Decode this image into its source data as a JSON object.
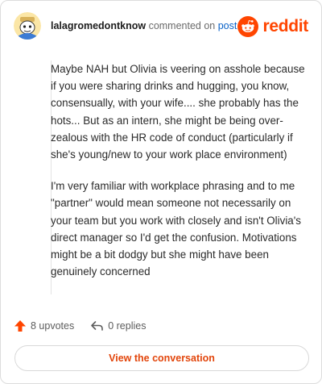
{
  "comment": {
    "username": "lalagromedontknow",
    "action_text": "commented on",
    "post_link": "post",
    "paragraphs": [
      "Maybe NAH but Olivia is veering on asshole because if you were sharing drinks and hugging, you know, consensually, with your wife.... she probably has the hots... But as an intern, she might be being over-zealous with the HR code of conduct (particularly if she's young/new to your work place environment)",
      "I'm very familiar with workplace phrasing and to me \"partner\" would mean someone not necessarily on your team but you work with closely and isn't Olivia's direct manager so I'd get the confusion. Motivations might be a bit dodgy but she might have been genuinely concerned"
    ],
    "upvotes": "8 upvotes",
    "replies": "0 replies"
  },
  "brand": {
    "wordmark": "reddit",
    "color": "#ff4500"
  },
  "cta": {
    "label": "View the conversation"
  },
  "icons": {
    "avatar": "snoo-avatar",
    "logo": "reddit-snoo-icon",
    "upvote": "upvote-arrow-icon",
    "reply": "reply-arrow-icon"
  }
}
